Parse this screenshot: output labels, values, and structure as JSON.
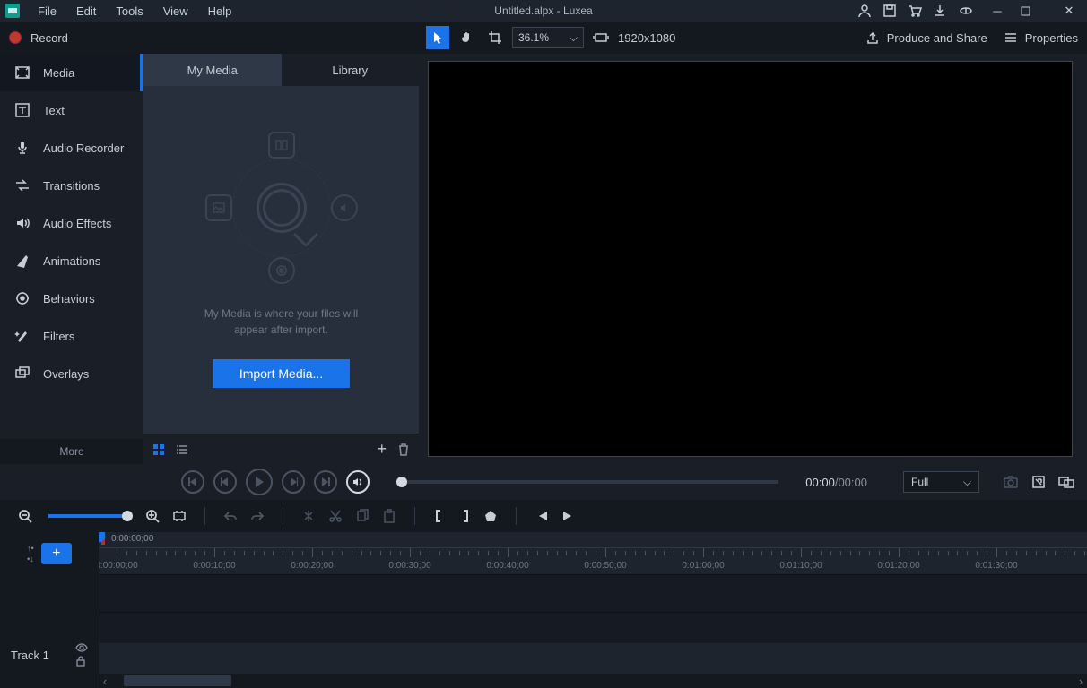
{
  "title": "Untitled.alpx - Luxea",
  "menu": [
    "File",
    "Edit",
    "Tools",
    "View",
    "Help"
  ],
  "record_label": "Record",
  "zoom_value": "36.1%",
  "resolution": "1920x1080",
  "produce_label": "Produce and Share",
  "properties_label": "Properties",
  "sidebar": [
    {
      "label": "Media",
      "icon": "media"
    },
    {
      "label": "Text",
      "icon": "text"
    },
    {
      "label": "Audio Recorder",
      "icon": "mic"
    },
    {
      "label": "Transitions",
      "icon": "transitions"
    },
    {
      "label": "Audio Effects",
      "icon": "audio-fx"
    },
    {
      "label": "Animations",
      "icon": "animations"
    },
    {
      "label": "Behaviors",
      "icon": "behaviors"
    },
    {
      "label": "Filters",
      "icon": "filters"
    },
    {
      "label": "Overlays",
      "icon": "overlays"
    }
  ],
  "sidebar_more": "More",
  "media_tabs": {
    "mymedia": "My Media",
    "library": "Library"
  },
  "media_hint1": "My Media is where your files will",
  "media_hint2": "appear after import.",
  "import_label": "Import Media...",
  "playback": {
    "current": "00:00",
    "duration": "00:00",
    "size_mode": "Full"
  },
  "timeline": {
    "playhead_tc": "0:00:00;00",
    "labels": [
      "0:00:00;00",
      "0:00:10;00",
      "0:00:20;00",
      "0:00:30;00",
      "0:00:40;00",
      "0:00:50;00",
      "0:01:00;00",
      "0:01:10;00",
      "0:01:20;00",
      "0:01:30;00"
    ],
    "track1": "Track 1"
  }
}
